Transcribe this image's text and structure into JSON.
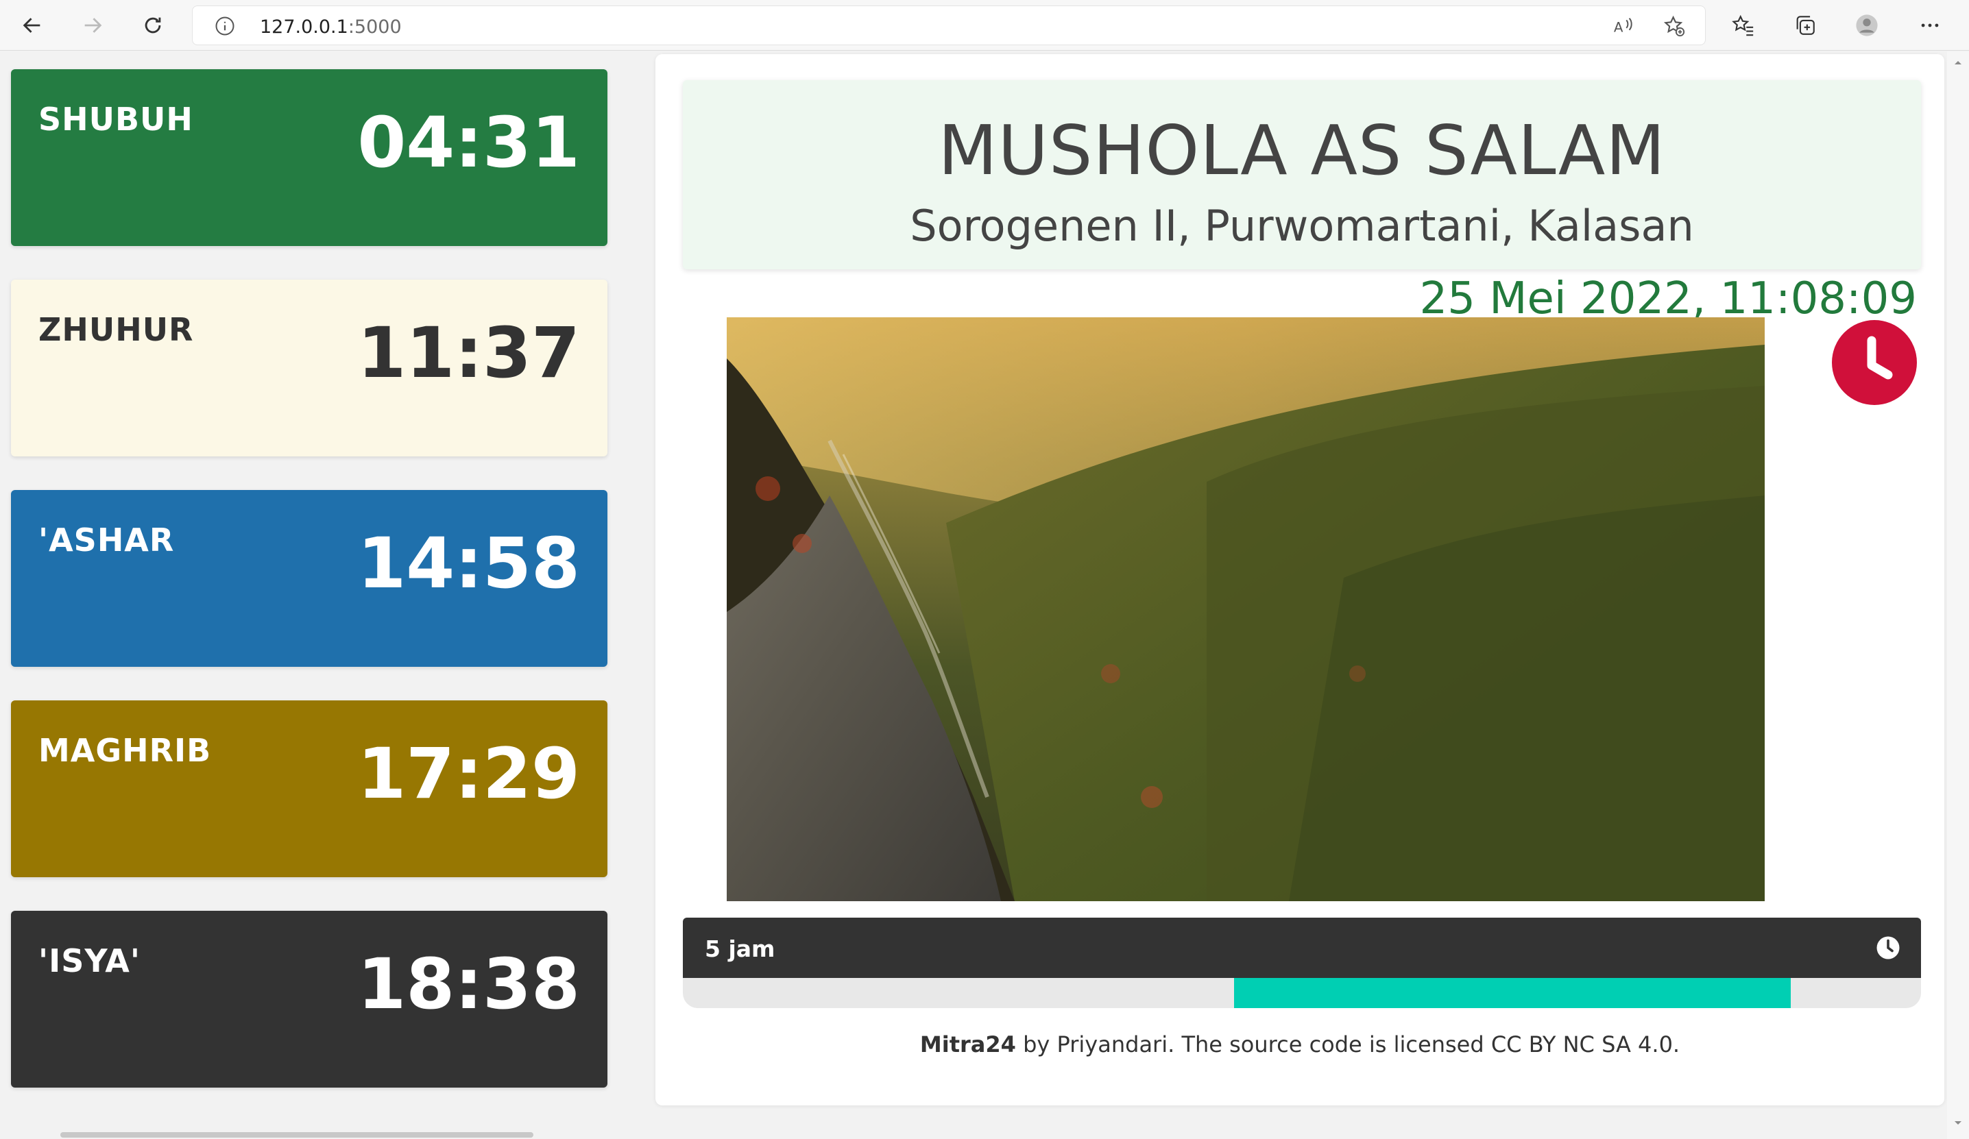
{
  "browser": {
    "url_host": "127.0.0.1",
    "url_port": ":5000",
    "icons": [
      "back-arrow-icon",
      "forward-arrow-icon",
      "refresh-icon",
      "info-icon",
      "read-aloud-icon",
      "add-favorite-icon",
      "favorites-icon",
      "collections-icon",
      "profile-icon",
      "more-icon"
    ]
  },
  "prayers": [
    {
      "name": "SHUBUH",
      "time": "04:31",
      "bg": "#247c42",
      "fg": "#ffffff"
    },
    {
      "name": "ZHUHUR",
      "time": "11:37",
      "bg": "#fcf8e6",
      "fg": "#333333"
    },
    {
      "name": "'ASHAR",
      "time": "14:58",
      "bg": "#1f70ac",
      "fg": "#ffffff"
    },
    {
      "name": "MAGHRIB",
      "time": "17:29",
      "bg": "#977702",
      "fg": "#ffffff"
    },
    {
      "name": "'ISYA'",
      "time": "18:38",
      "bg": "#333333",
      "fg": "#ffffff"
    }
  ],
  "header": {
    "mosque_name": "MUSHOLA AS SALAM",
    "address": "Sorogenen II, Purwomartani, Kalasan"
  },
  "datetime": "25 Mei 2022, 11:08:09",
  "countdown": {
    "label": "5 jam",
    "progress_start": 0.445,
    "progress_end": 0.895
  },
  "footer": {
    "brand": "Mitra24",
    "text": " by Priyandari. The source code is licensed CC BY NC SA 4.0."
  },
  "colors": {
    "accent_green": "#227a3c",
    "clock_red": "#d0103a",
    "progress_teal": "#00cfb3"
  }
}
